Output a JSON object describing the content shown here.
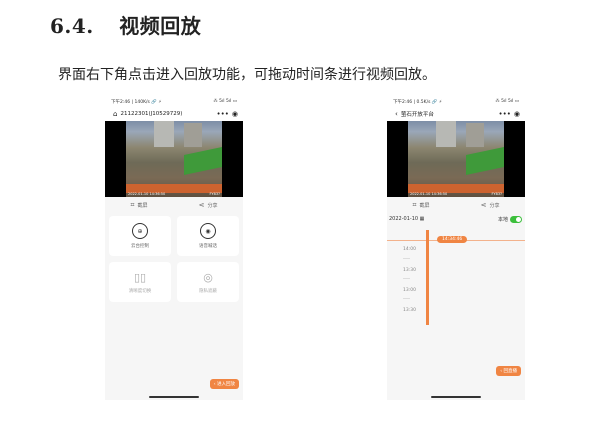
{
  "section": {
    "number": "6.4.",
    "title": "视频回放"
  },
  "intro": "界面右下角点击进入回放功能，可拖动时间条进行视频回放。",
  "phone_live": {
    "status_time": "下午2:46 | 140K/s 🔗 ⚡",
    "status_right": "⁂ 5ıl 5ıl ▭",
    "nav_title": "21122301(J10529729)",
    "video_osd_left": "2022-01-10 14:36:50",
    "video_osd_right": "FY83?",
    "actions": {
      "screenshot": "截屏",
      "share": "分享"
    },
    "cards": [
      {
        "icon": "⊕",
        "label": "云台控制"
      },
      {
        "icon": "◉",
        "label": "语音喊话"
      },
      {
        "icon": "▯▯",
        "label": "清晰度切换"
      },
      {
        "icon": "◎",
        "label": "隐私遮蔽"
      }
    ],
    "playback_button": "‹ 进入回放"
  },
  "phone_playback": {
    "status_time": "下午2:46 | 0.5K/s 🔗 ⚡",
    "status_right": "⁂ 5ıl 5ıl ▭",
    "nav_title": "萤石开放平台",
    "video_osd_left": "2022-01-10 14:36:50",
    "video_osd_right": "FY83?",
    "actions": {
      "screenshot": "截屏",
      "share": "分享"
    },
    "date": "2022-01-10",
    "local_label": "本地",
    "current_time": "14:34:46",
    "times": [
      "14:00",
      "13:30",
      "13:00",
      "13:30"
    ],
    "back_button": "‹ 回直播"
  },
  "colors": {
    "accent": "#f08543",
    "toggle_on": "#3cbf3c"
  }
}
